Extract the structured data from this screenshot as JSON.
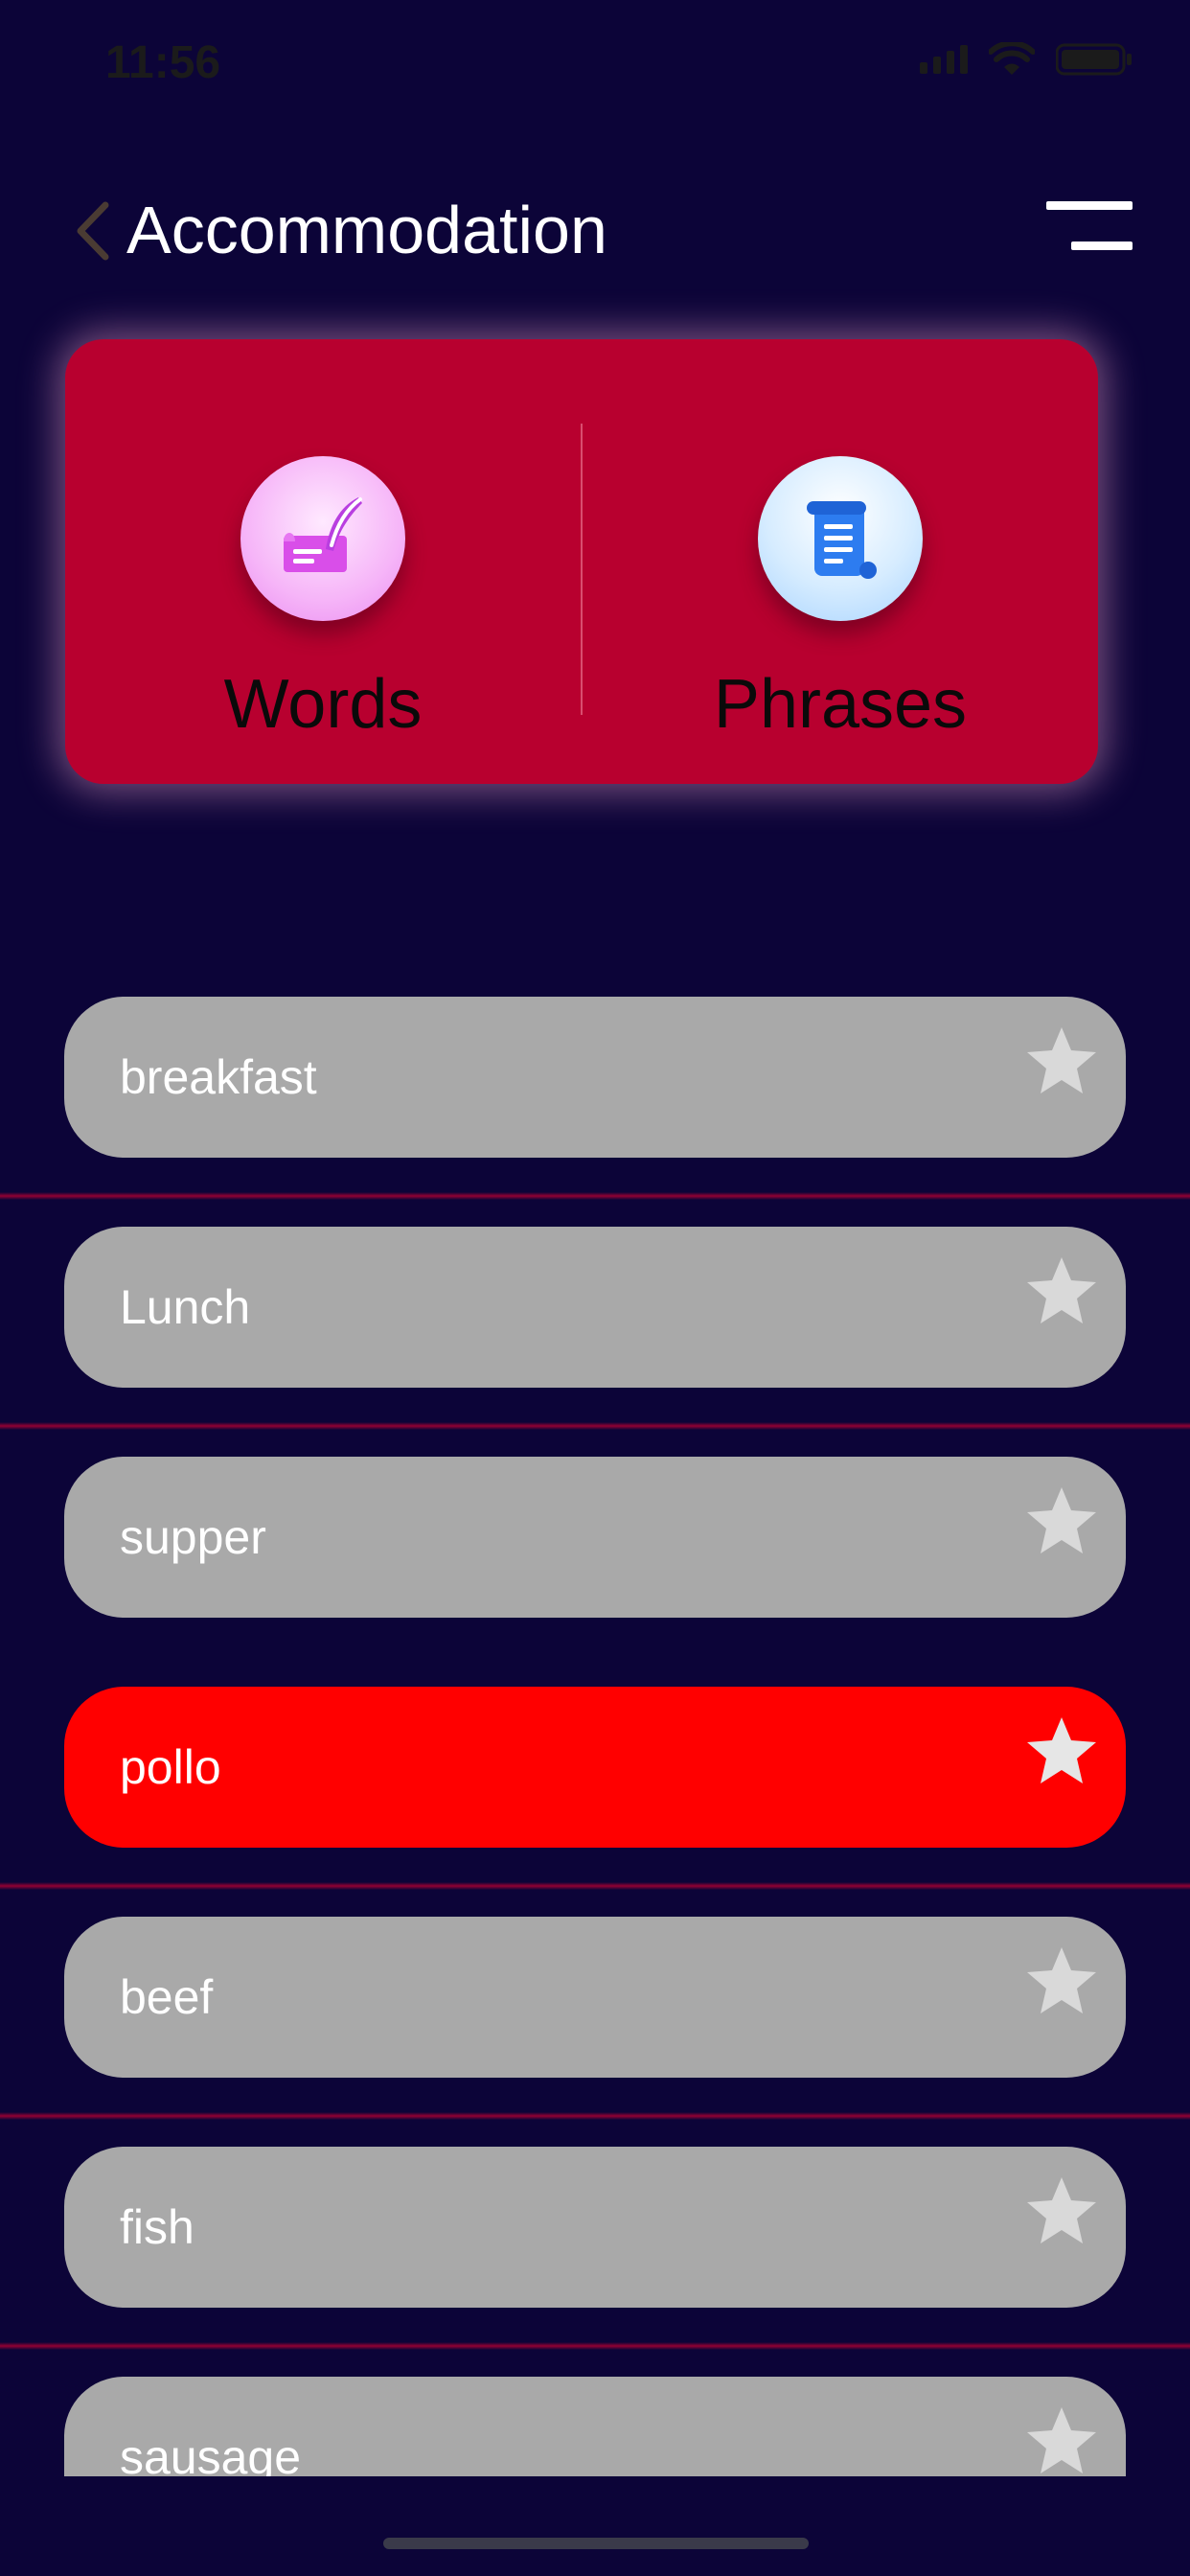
{
  "status_bar": {
    "time": "11:56"
  },
  "header": {
    "title": "Accommodation"
  },
  "modes": {
    "words_label": "Words",
    "phrases_label": "Phrases"
  },
  "words": [
    {
      "text": "breakfast",
      "selected": false
    },
    {
      "text": "Lunch",
      "selected": false
    },
    {
      "text": "supper",
      "selected": false
    },
    {
      "text": "pollo",
      "selected": true
    },
    {
      "text": "beef",
      "selected": false
    },
    {
      "text": "fish",
      "selected": false
    },
    {
      "text": "sausage",
      "selected": false
    }
  ],
  "colors": {
    "background": "#0c0438",
    "card": "#b8002f",
    "row": "#a9a9a9",
    "row_selected": "#ff0000"
  }
}
